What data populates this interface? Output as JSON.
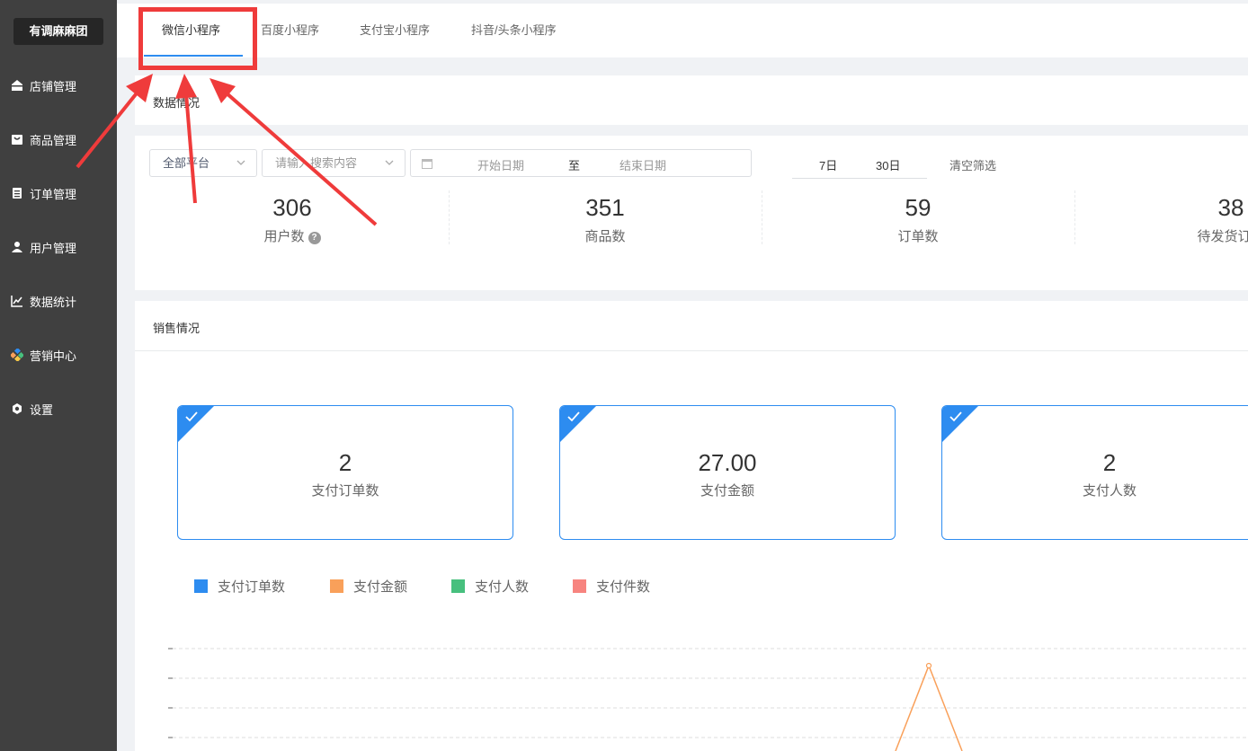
{
  "sidebar": {
    "brand": "有调麻麻团",
    "items": [
      {
        "label": "店铺管理",
        "icon": "store-icon"
      },
      {
        "label": "商品管理",
        "icon": "bag-icon"
      },
      {
        "label": "订单管理",
        "icon": "clipboard-icon"
      },
      {
        "label": "用户管理",
        "icon": "user-icon"
      },
      {
        "label": "数据统计",
        "icon": "line-chart-icon"
      },
      {
        "label": "营销中心",
        "icon": "colorful-blocks-icon"
      },
      {
        "label": "设置",
        "icon": "gear-icon"
      }
    ]
  },
  "tabs": [
    {
      "label": "微信小程序",
      "active": true
    },
    {
      "label": "百度小程序",
      "active": false
    },
    {
      "label": "支付宝小程序",
      "active": false
    },
    {
      "label": "抖音/头条小程序",
      "active": false
    }
  ],
  "data_overview": {
    "title": "数据情况",
    "filters": {
      "platform": "全部平台",
      "search_placeholder": "请输入搜索内容",
      "start_placeholder": "开始日期",
      "separator": "至",
      "end_placeholder": "结束日期",
      "quick_7": "7日",
      "quick_30": "30日",
      "clear": "清空筛选"
    },
    "stats": [
      {
        "value": "306",
        "label": "用户数",
        "help": "?"
      },
      {
        "value": "351",
        "label": "商品数"
      },
      {
        "value": "59",
        "label": "订单数"
      },
      {
        "value": "38",
        "label": "待发货订单"
      }
    ]
  },
  "sales": {
    "title": "销售情况",
    "cards": [
      {
        "value": "2",
        "label": "支付订单数"
      },
      {
        "value": "27.00",
        "label": "支付金额"
      },
      {
        "value": "2",
        "label": "支付人数"
      }
    ],
    "legend": [
      {
        "label": "支付订单数",
        "color": "#2d8cf0"
      },
      {
        "label": "支付金额",
        "color": "#f9a05a"
      },
      {
        "label": "支付人数",
        "color": "#47c07e"
      },
      {
        "label": "支付件数",
        "color": "#f7847f"
      }
    ]
  },
  "colors": {
    "accent": "#2d8cf0",
    "sidebar": "#404040",
    "annotation": "#ef3b3b"
  }
}
